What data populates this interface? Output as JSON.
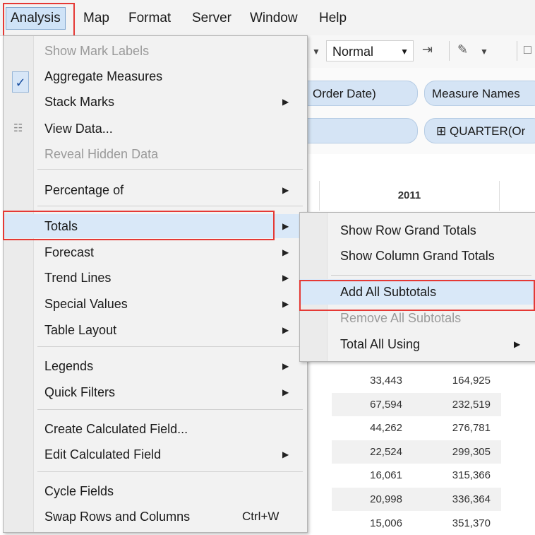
{
  "menubar": {
    "items": [
      "Analysis",
      "Map",
      "Format",
      "Server",
      "Window",
      "Help"
    ]
  },
  "toolbar": {
    "mark_type": "Normal"
  },
  "shelves": {
    "columns_pill_1": "Order Date)",
    "columns_pill_2": "Measure Names",
    "rows_pill_1": "",
    "rows_pill_2": "⊞ QUARTER(Or"
  },
  "table": {
    "column_header": "2011",
    "rows": [
      [
        "33,443",
        "164,925"
      ],
      [
        "67,594",
        "232,519"
      ],
      [
        "44,262",
        "276,781"
      ],
      [
        "22,524",
        "299,305"
      ],
      [
        "16,061",
        "315,366"
      ],
      [
        "20,998",
        "336,364"
      ],
      [
        "15,006",
        "351,370"
      ]
    ]
  },
  "analysis_menu": {
    "show_mark_labels": "Show Mark Labels",
    "aggregate_measures": "Aggregate Measures",
    "stack_marks": "Stack Marks",
    "view_data": "View Data...",
    "reveal_hidden_data": "Reveal Hidden Data",
    "percentage_of": "Percentage of",
    "totals": "Totals",
    "forecast": "Forecast",
    "trend_lines": "Trend Lines",
    "special_values": "Special Values",
    "table_layout": "Table Layout",
    "legends": "Legends",
    "quick_filters": "Quick Filters",
    "create_calculated_field": "Create Calculated Field...",
    "edit_calculated_field": "Edit Calculated Field",
    "cycle_fields": "Cycle Fields",
    "swap_rows_columns": "Swap Rows and Columns",
    "swap_shortcut": "Ctrl+W",
    "check_glyph": "✓",
    "submenu_glyph": "▶"
  },
  "totals_submenu": {
    "show_row_grand_totals": "Show Row Grand Totals",
    "show_column_grand_totals": "Show Column Grand Totals",
    "add_all_subtotals": "Add All Subtotals",
    "remove_all_subtotals": "Remove All Subtotals",
    "total_all_using": "Total All Using"
  },
  "colors": {
    "highlight_box": "#e53935",
    "menu_bg": "#f2f2f2",
    "selection_bg": "#d9e8f8",
    "pill_bg": "#d5e4f5"
  }
}
